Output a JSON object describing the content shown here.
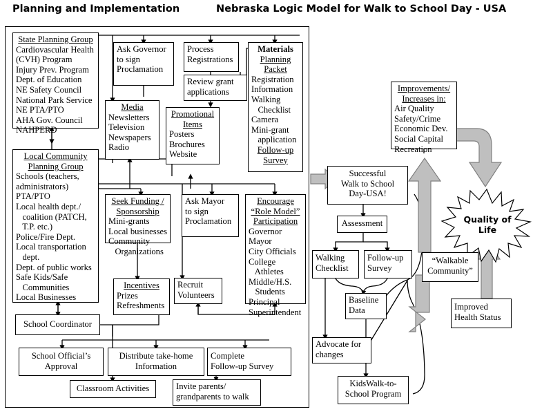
{
  "titles": {
    "left": "Planning and Implementation",
    "main": "Nebraska Logic Model for Walk to School Day - USA"
  },
  "colors": {
    "line": "#000000",
    "fat_arrow_fill": "#BFBFBF",
    "fat_arrow_stroke": "#808080",
    "background": "#FFFFFF"
  },
  "boxes": {
    "state_planning": {
      "head1": "State Planning Group",
      "lines": [
        "Cardiovascular Health",
        "(CVH) Program",
        "Injury Prev. Program",
        "Dept. of Education",
        "NE Safety Council",
        "National Park Service",
        "NE PTA/PTO",
        "AHA    Gov. Council",
        "NAHPERD"
      ]
    },
    "local_community": {
      "head1": "Local Community",
      "head2": "Planning Group",
      "lines": [
        "Schools (teachers,",
        "administrators)",
        "PTA/PTO",
        "Local health dept./",
        "   coalition (PATCH,",
        "   T.P. etc.)",
        "Police/Fire Dept.",
        "Local transportation",
        "   dept.",
        "Dept. of public works",
        "Safe Kids/Safe",
        "   Communities",
        "Local Businesses"
      ]
    },
    "school_coordinator": {
      "line1": "School Coordinator"
    },
    "ask_governor": {
      "line1": "Ask Governor",
      "line2": "to sign",
      "line3": "Proclamation"
    },
    "media": {
      "head1": "Media",
      "lines": [
        "Newsletters",
        "Television",
        "Newspapers",
        "Radio"
      ]
    },
    "process_registrations": {
      "line1": "Process",
      "line2": "Registrations"
    },
    "review_grant": {
      "line1": "Review grant",
      "line2": "applications"
    },
    "promotional_items": {
      "head1": "Promotional",
      "head2": "Items",
      "lines": [
        "Posters",
        "Brochures",
        "Website"
      ]
    },
    "materials": {
      "bold": "Materials",
      "head1": "Planning",
      "head2": "Packet",
      "lines": [
        "Registration",
        "Information",
        "Walking",
        "   Checklist",
        "Camera",
        "Mini-grant",
        "   application"
      ],
      "foot1": "Follow-up",
      "foot2": "Survey"
    },
    "seek_funding": {
      "head1": "Seek Funding /",
      "head2": "Sponsorship",
      "lines": [
        "Mini-grants",
        "Local businesses",
        "Community",
        "   Organizations"
      ]
    },
    "incentives": {
      "head1": "Incentives",
      "lines": [
        "Prizes",
        "Refreshments"
      ]
    },
    "ask_mayor": {
      "line1": "Ask Mayor",
      "line2": "to sign",
      "line3": "Proclamation"
    },
    "recruit_volunteers": {
      "line1": "Recruit",
      "line2": "Volunteers"
    },
    "encourage": {
      "head1": "Encourage",
      "head2": "“Role Model”",
      "head3": "Participation",
      "lines": [
        "Governor",
        "Mayor",
        "City Officials",
        "College",
        "   Athletes",
        "Middle/H.S.",
        "   Students",
        "Principal",
        "Superintendent"
      ]
    },
    "school_official_approval": {
      "line1": "School Official’s",
      "line2": "Approval"
    },
    "distribute_takehome": {
      "line1": "Distribute take-home",
      "line2": "Information"
    },
    "complete_followup": {
      "line1": "Complete",
      "line2": "Follow-up Survey"
    },
    "classroom_activities": {
      "line1": "Classroom Activities"
    },
    "invite_parents": {
      "line1": "Invite parents/",
      "line2": "grandparents to walk"
    },
    "successful_walk": {
      "line1": "Successful",
      "line2": "Walk to School",
      "line3": "Day-USA!"
    },
    "assessment": {
      "line1": "Assessment"
    },
    "walking_checklist": {
      "line1": "Walking",
      "line2": "Checklist"
    },
    "followup_survey": {
      "line1": "Follow-up",
      "line2": "Survey"
    },
    "baseline_data": {
      "line1": "Baseline",
      "line2": "Data"
    },
    "advocate_changes": {
      "line1": "Advocate for",
      "line2": "changes"
    },
    "kidswalk": {
      "line1": "KidsWalk-to-",
      "line2": "School Program"
    },
    "improvements": {
      "head1": "Improvements/",
      "head2": "Increases in:",
      "lines": [
        "Air Quality",
        "Safety/Crime",
        "Economic Dev.",
        "Social Capital",
        "Recreation"
      ]
    },
    "walkable_community": {
      "line1": "“Walkable",
      "line2": "Community”"
    },
    "improved_health": {
      "line1": "Improved",
      "line2": "Health Status"
    },
    "quality_of_life": {
      "line1": "Quality of",
      "line2": "Life"
    }
  }
}
